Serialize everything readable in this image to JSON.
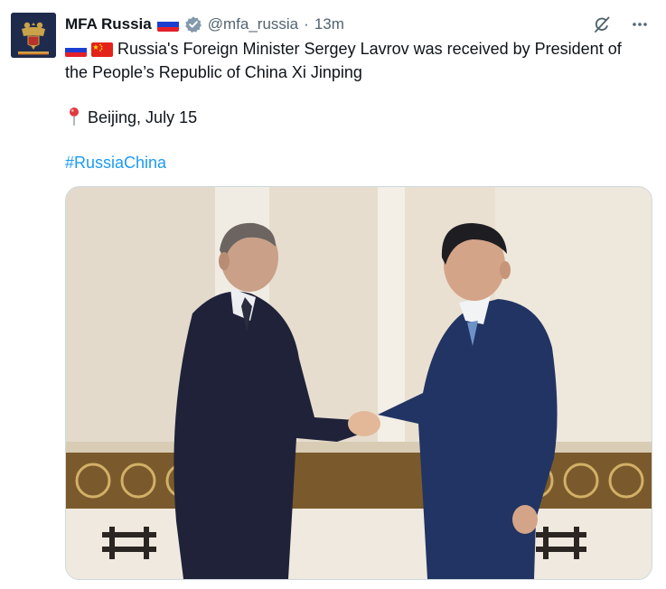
{
  "tweet": {
    "author_name": "MFA Russia",
    "handle": "@mfa_russia",
    "separator": "·",
    "time": "13m",
    "line1": "Russia's Foreign Minister Sergey Lavrov was received by President of",
    "line2": "the People’s Republic of China Xi Jinping",
    "location": "Beijing, July 15",
    "hashtag": "#RussiaChina"
  },
  "icons": {
    "verified": "verified-badge-icon",
    "grok": "grok-icon",
    "more": "more-icon",
    "pin": "round-pushpin-icon"
  },
  "colors": {
    "link": "#1d9bf0",
    "muted": "#536471",
    "text": "#0f1419",
    "avatar_bg": "#1f2b4d"
  }
}
